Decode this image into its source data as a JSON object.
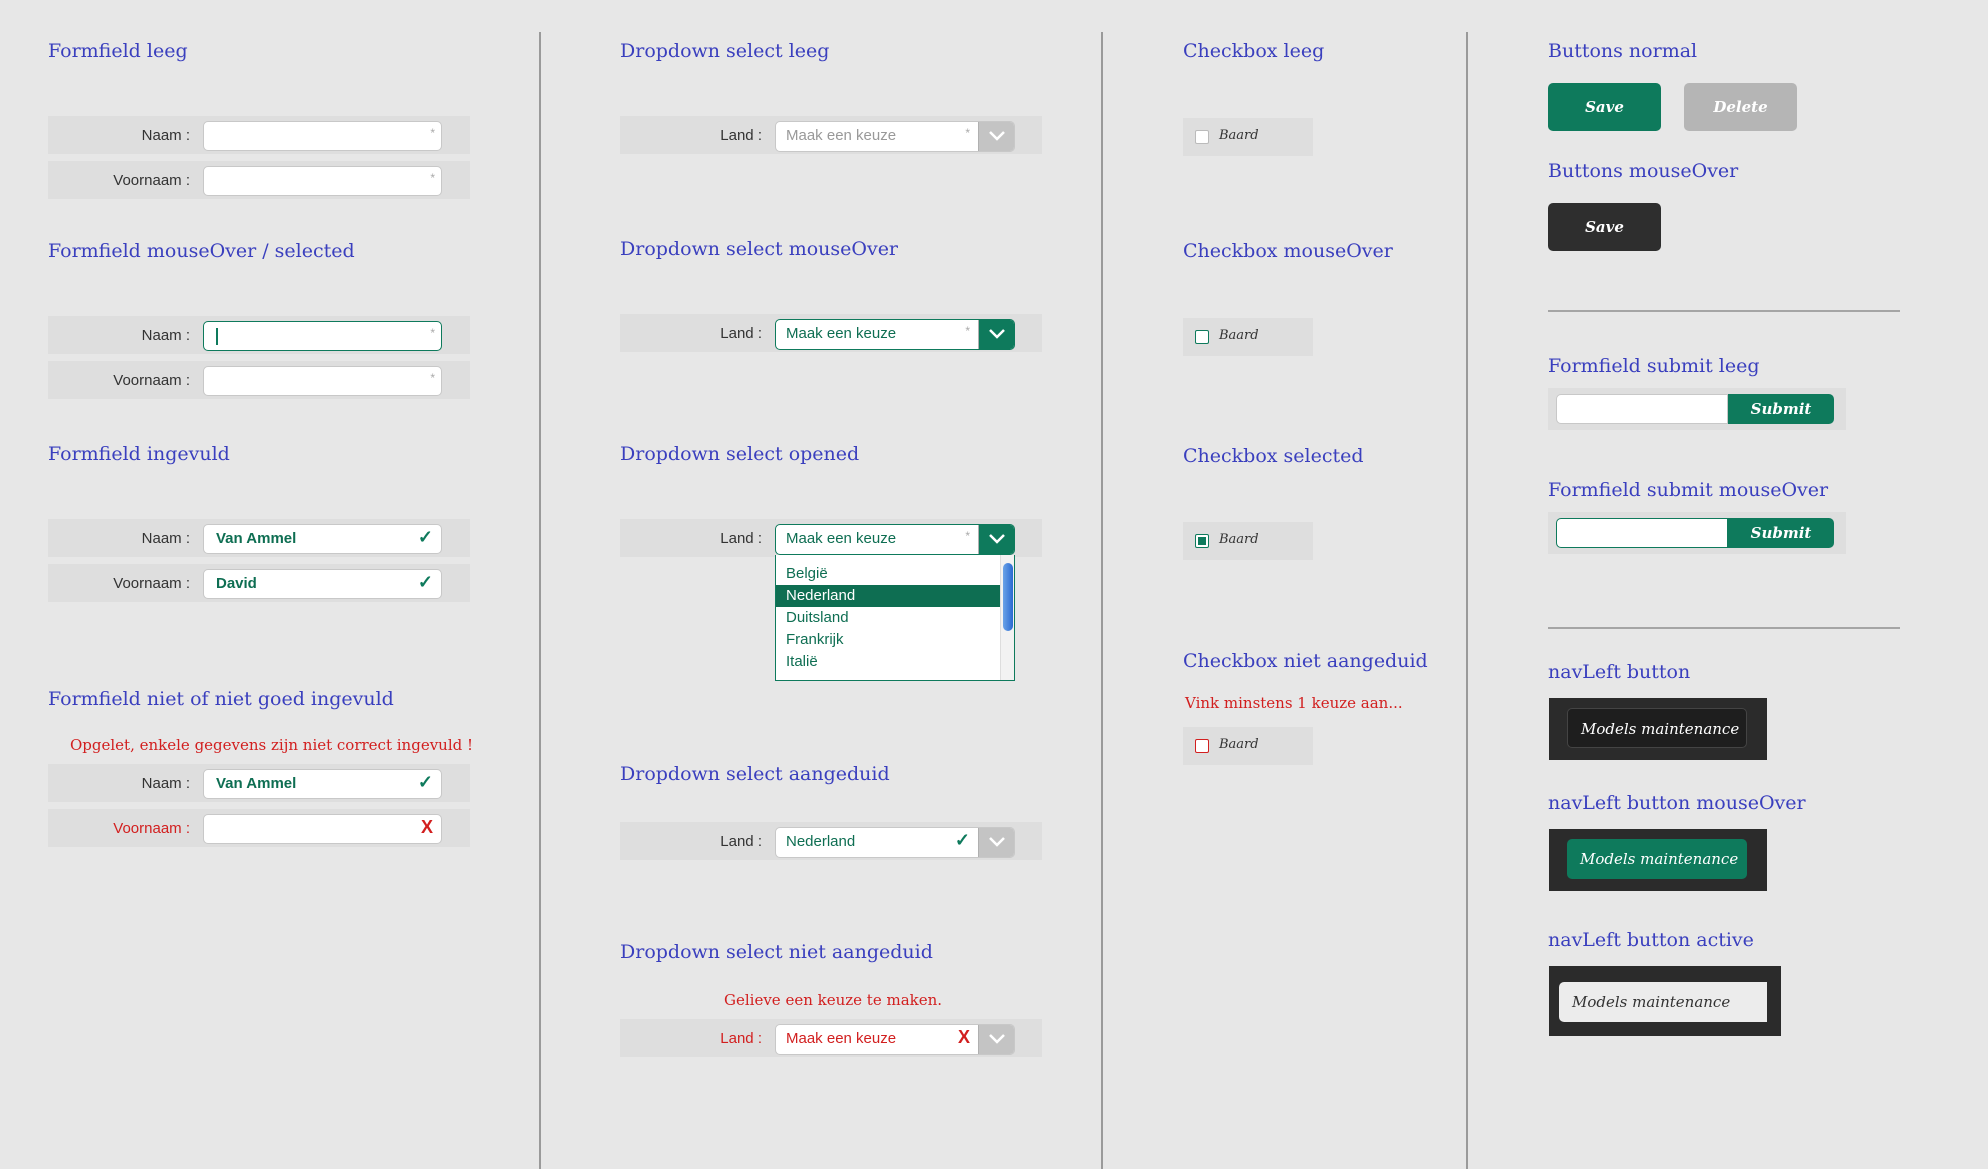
{
  "col1": {
    "section_empty": "Formfield leeg",
    "section_hover": "Formfield mouseOver / selected",
    "section_filled": "Formfield ingevuld",
    "section_invalid": "Formfield niet of niet goed ingevuld",
    "invalid_message": "Opgelet, enkele gegevens zijn niet correct ingevuld !",
    "label_naam": "Naam :",
    "label_voornaam": "Voornaam :",
    "value_naam": "Van Ammel",
    "value_voornaam": "David",
    "required_mark": "*",
    "check_glyph": "✓",
    "x_glyph": "X"
  },
  "col2": {
    "section_empty": "Dropdown select leeg",
    "section_hover": "Dropdown select mouseOver",
    "section_opened": "Dropdown select opened",
    "section_selected": "Dropdown select aangeduid",
    "section_invalid": "Dropdown select niet aangeduid",
    "invalid_message": "Gelieve een keuze te maken.",
    "label_land": "Land :",
    "placeholder": "Maak een keuze",
    "selected_value": "Nederland",
    "options": [
      "België",
      "Nederland",
      "Duitsland",
      "Frankrijk",
      "Italië"
    ],
    "selected_option_index": 1
  },
  "col3": {
    "section_empty": "Checkbox leeg",
    "section_hover": "Checkbox mouseOver",
    "section_selected": "Checkbox selected",
    "section_invalid": "Checkbox niet aangeduid",
    "invalid_message": "Vink minstens 1 keuze aan...",
    "checkbox_label": "Baard"
  },
  "col4": {
    "section_buttons_normal": "Buttons normal",
    "btn_save": "Save",
    "btn_delete": "Delete",
    "section_buttons_hover": "Buttons mouseOver",
    "section_submit_empty": "Formfield submit leeg",
    "section_submit_hover": "Formfield submit mouseOver",
    "btn_submit": "Submit",
    "section_nav": "navLeft button",
    "section_nav_hover": "navLeft button mouseOver",
    "section_nav_active": "navLeft button active",
    "nav_label": "Models maintenance"
  },
  "colors": {
    "title": "#3a3fbe",
    "accent_green": "#0e7a5c",
    "error_red": "#d21f1f",
    "background": "#e7e7e7"
  }
}
